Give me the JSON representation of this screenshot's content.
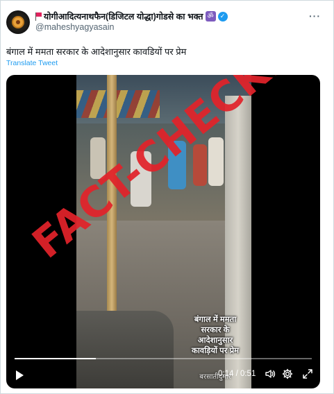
{
  "tweet": {
    "display_name": "योगीआदित्यनाथफैन(डिजिटल योद्धा)गोडसे का भक्त",
    "om_symbol": "ॐ",
    "handle": "@maheshyagyasain",
    "more_label": "···",
    "text": "बंगाल में ममता सरकार के आदेशानुसार कावडियों पर प्रेम",
    "translate_label": "Translate Tweet"
  },
  "video": {
    "caption_lines": [
      "बंगाल में ममता",
      "सरकार के",
      "आदेशानुसार",
      "कावड़ियों पर प्रेम"
    ],
    "caption_sub": "बरसातीदुमार",
    "stamp_text": "FACT-CHECKED",
    "time_display": "0:14 / 0:51",
    "progress_fraction": 0.2745
  },
  "icons": {
    "flag": "red-flag-icon",
    "verified": "verified-badge-icon",
    "play": "play-icon",
    "volume": "volume-icon",
    "settings": "gear-icon",
    "fullscreen": "fullscreen-icon"
  },
  "colors": {
    "link": "#1d9bf0",
    "muted": "#536471",
    "stamp": "#e2232a",
    "verified": "#1d9bf0"
  }
}
